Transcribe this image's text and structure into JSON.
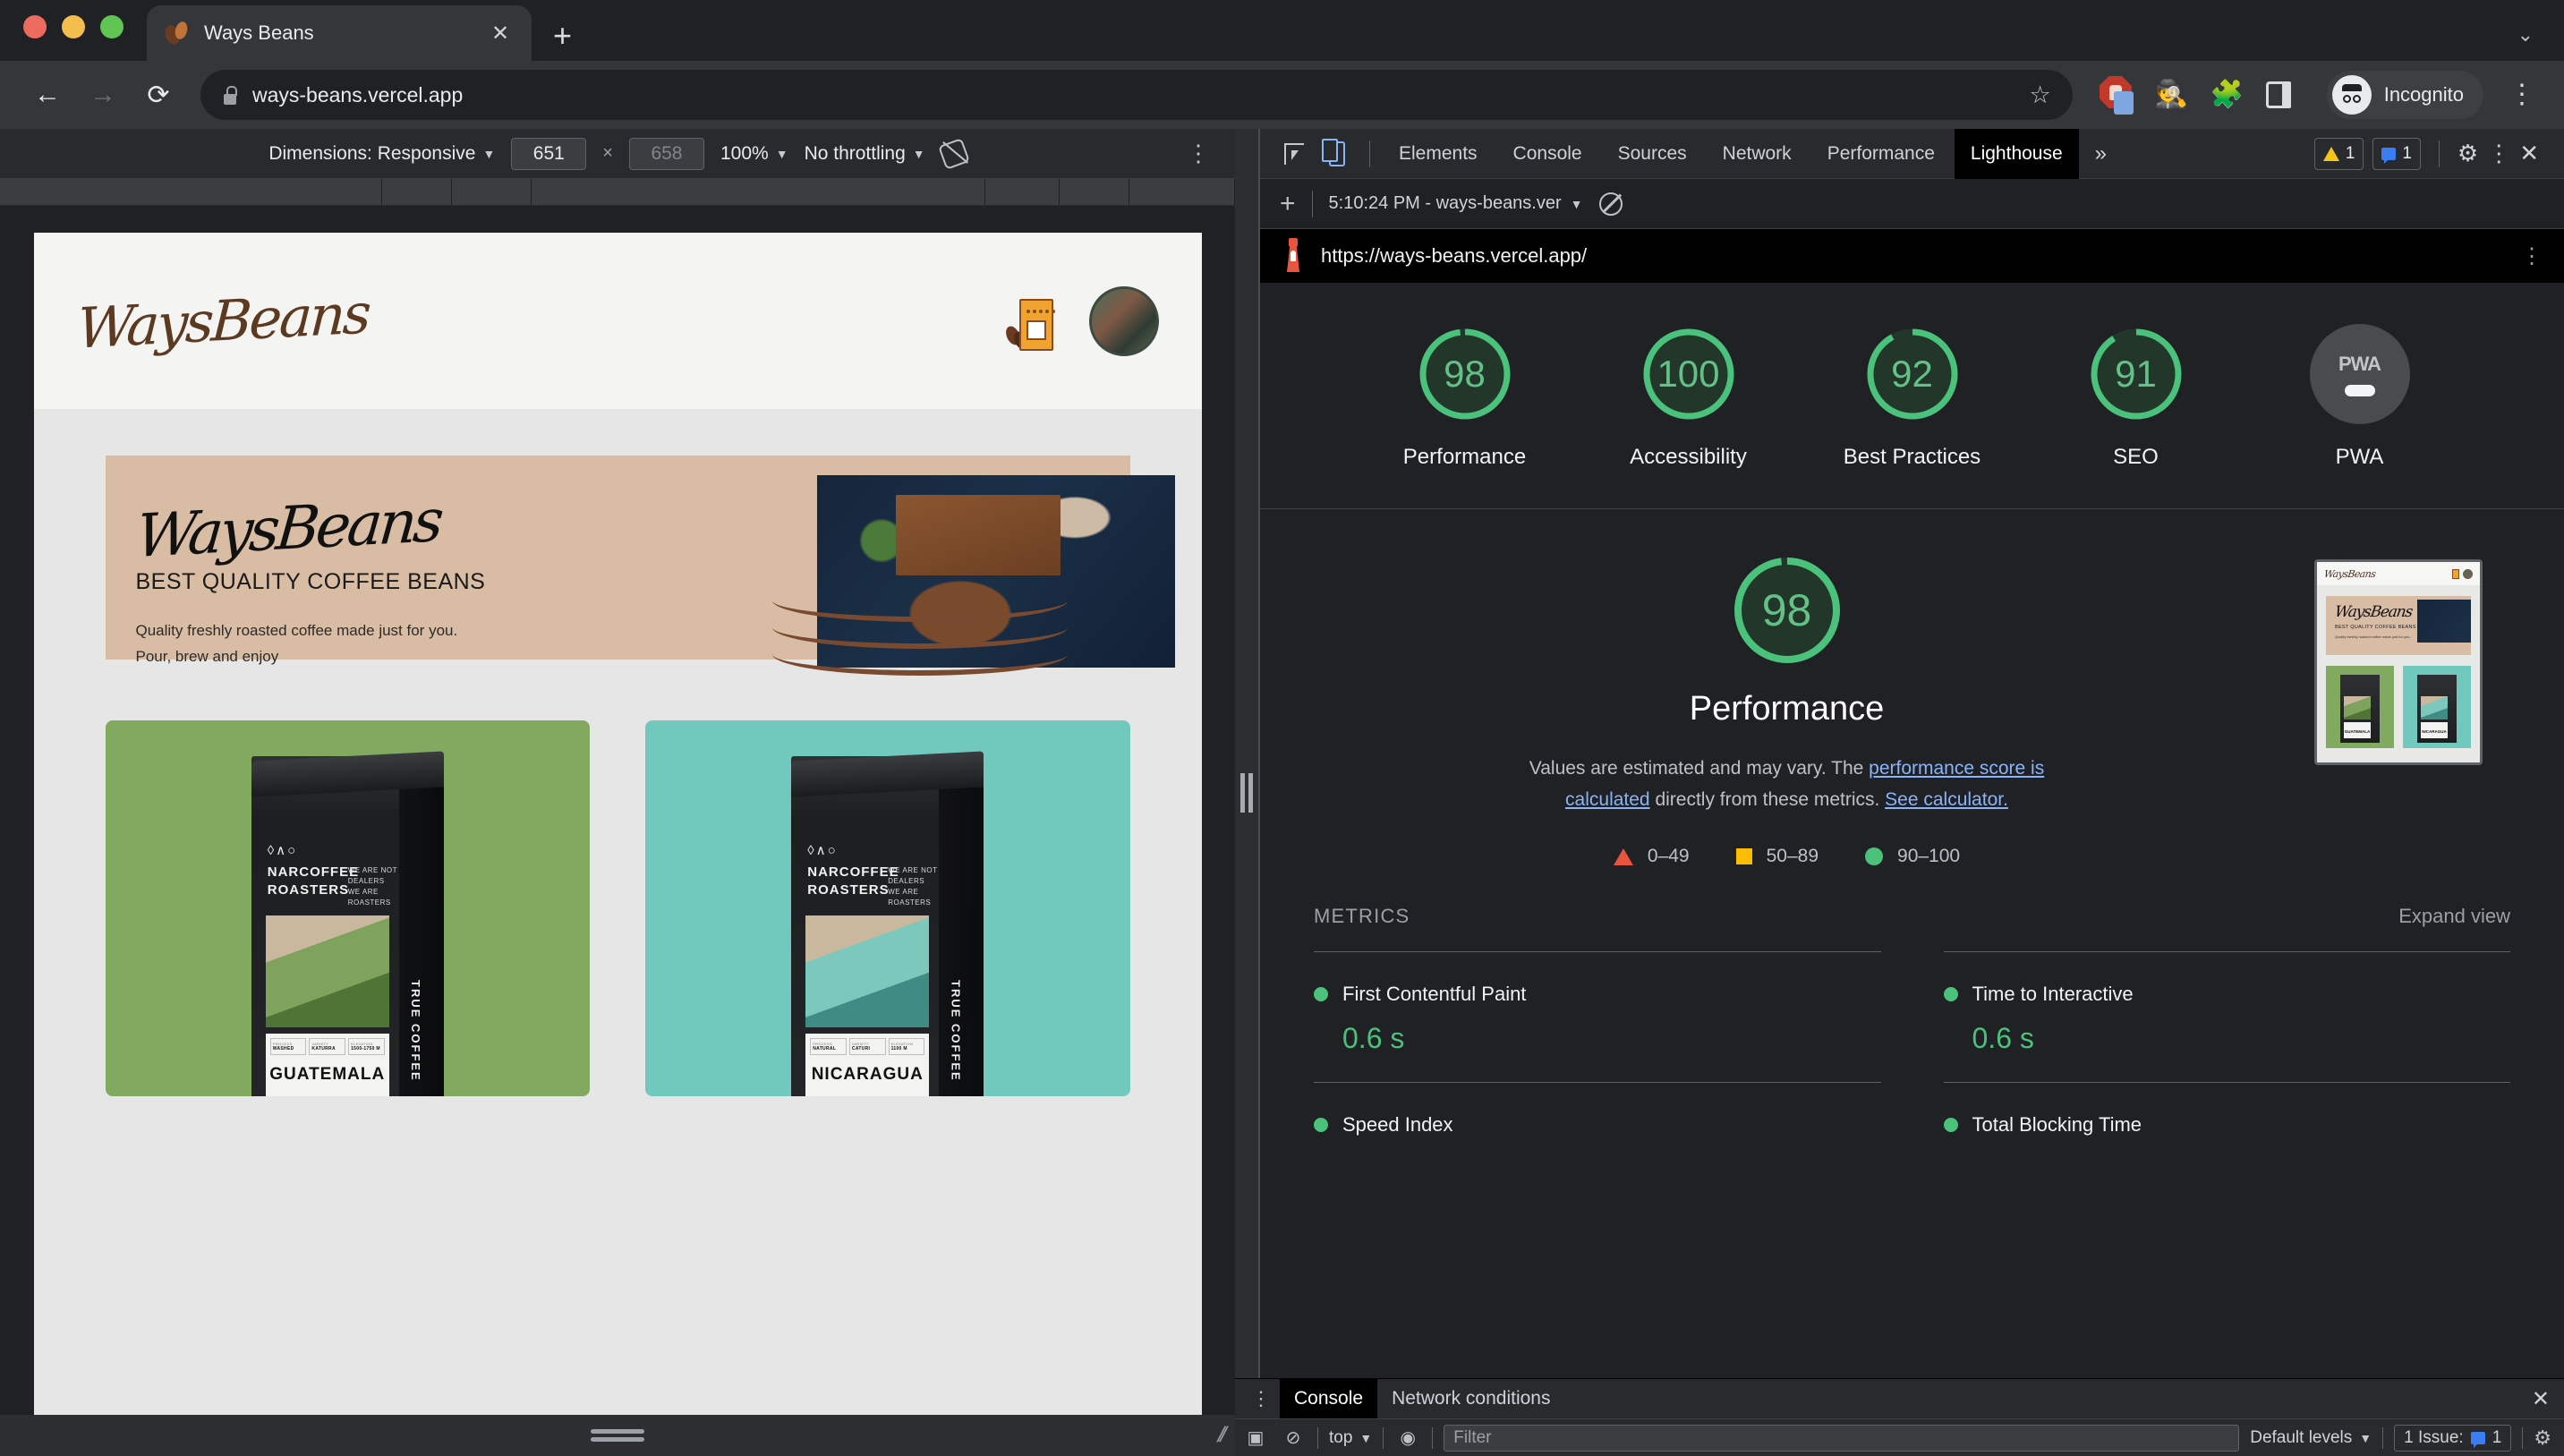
{
  "browser": {
    "tab": {
      "title": "Ways Beans",
      "favicon": "coffee-bean-icon",
      "close_label": "✕"
    },
    "new_tab_label": "+",
    "window_chevron": "⌄",
    "nav": {
      "back": "←",
      "forward": "→",
      "reload": "⟳"
    },
    "omnibox": {
      "url": "ways-beans.vercel.app",
      "lock": "lock-icon",
      "star": "☆"
    },
    "extensions": [
      "ublock-origin-icon",
      "privacy-agent-icon",
      "puzzle-icon",
      "side-panel-icon"
    ],
    "profile": {
      "label": "Incognito"
    },
    "menu_label": "⋮"
  },
  "device_toolbar": {
    "dimensions_label": "Dimensions: Responsive",
    "width": "651",
    "height_placeholder": "658",
    "zoom": "100%",
    "throttling": "No throttling",
    "rotate_icon": "rotate-device-icon",
    "more_label": "⋮"
  },
  "devtools": {
    "inspect_icon": "inspect-element-icon",
    "device_icon": "toggle-device-toolbar-icon",
    "tabs": [
      "Elements",
      "Console",
      "Sources",
      "Network",
      "Performance",
      "Lighthouse"
    ],
    "active_tab": "Lighthouse",
    "more_tabs": "»",
    "warning_count": "1",
    "issue_count": "1",
    "settings_icon": "gear-icon",
    "menu_icon": "⋮",
    "close_icon": "✕"
  },
  "lighthouse_toolbar": {
    "add_label": "+",
    "run_select": "5:10:24 PM - ways-beans.ver",
    "clear_icon": "clear-all-icon"
  },
  "lighthouse": {
    "audited_url": "https://ways-beans.vercel.app/",
    "url_menu": "⋮",
    "scores": [
      {
        "label": "Performance",
        "value": 98,
        "color": "#4BC27B"
      },
      {
        "label": "Accessibility",
        "value": 100,
        "color": "#4BC27B"
      },
      {
        "label": "Best Practices",
        "value": 92,
        "color": "#4BC27B"
      },
      {
        "label": "SEO",
        "value": 91,
        "color": "#4BC27B"
      },
      {
        "label": "PWA",
        "value": null,
        "badge": "PWA",
        "color": "#4A4B4D"
      }
    ],
    "detail": {
      "score": 98,
      "title": "Performance",
      "desc_part1": "Values are estimated and may vary. The ",
      "link1": "performance score is calculated",
      "desc_part2": " directly from these metrics. ",
      "link2": "See calculator.",
      "legend": [
        {
          "marker": "triangle",
          "range": "0–49",
          "color": "#E8543F"
        },
        {
          "marker": "square",
          "range": "50–89",
          "color": "#FBBC04"
        },
        {
          "marker": "circle",
          "range": "90–100",
          "color": "#4BC27B"
        }
      ]
    },
    "metrics_section": {
      "title": "METRICS",
      "expand_label": "Expand view",
      "items": [
        {
          "name": "First Contentful Paint",
          "value": "0.6 s",
          "status": "good"
        },
        {
          "name": "Time to Interactive",
          "value": "0.6 s",
          "status": "good"
        },
        {
          "name": "Speed Index",
          "value": "",
          "status": "good"
        },
        {
          "name": "Total Blocking Time",
          "value": "",
          "status": "good"
        }
      ]
    }
  },
  "drawer": {
    "menu_icon": "⋮",
    "tabs": [
      "Console",
      "Network conditions"
    ],
    "active_tab": "Console",
    "close_icon": "✕",
    "toolbar": {
      "sidebar_icon": "console-sidebar-icon",
      "clear_icon": "clear-console-icon",
      "context": "top",
      "eye_icon": "live-expression-icon",
      "filter_placeholder": "Filter",
      "levels": "Default levels",
      "issues": "1 Issue:",
      "issue_count": "1",
      "settings_icon": "console-settings-icon"
    }
  },
  "page": {
    "header": {
      "logo": "WaysBeans",
      "cart_icon": "coffee-bag-icon",
      "avatar": "user-avatar"
    },
    "hero": {
      "script_logo": "WaysBeans",
      "subtitle": "BEST QUALITY COFFEE BEANS",
      "description_line1": "Quality freshly roasted coffee made just for you.",
      "description_line2": "Pour, brew and enjoy",
      "image": "coffee-flatlay-photo"
    },
    "products": [
      {
        "name": "GUATEMALA",
        "bg_color": "#81A960",
        "brand_mark": "◊∧○",
        "brand": "NARCOFFEE\nROASTERS",
        "tagline": "WE ARE NOT DEALERS WE ARE ROASTERS",
        "specs": [
          {
            "key": "PROCESS",
            "value": "WASHED"
          },
          {
            "key": "VARIETY",
            "value": "KATURRA"
          },
          {
            "key": "ELEVATION",
            "value": "1500-1750 M"
          }
        ],
        "side_text": "TRUE COFFEE"
      },
      {
        "name": "NICARAGUA",
        "bg_color": "#71C9BD",
        "brand_mark": "◊∧○",
        "brand": "NARCOFFEE\nROASTERS",
        "tagline": "WE ARE NOT DEALERS WE ARE ROASTERS",
        "specs": [
          {
            "key": "PROCESS",
            "value": "NATURAL"
          },
          {
            "key": "VARIETY",
            "value": "CATURI"
          },
          {
            "key": "ELEVATION",
            "value": "1100 M"
          }
        ],
        "side_text": "TRUE COFFEE"
      }
    ]
  }
}
